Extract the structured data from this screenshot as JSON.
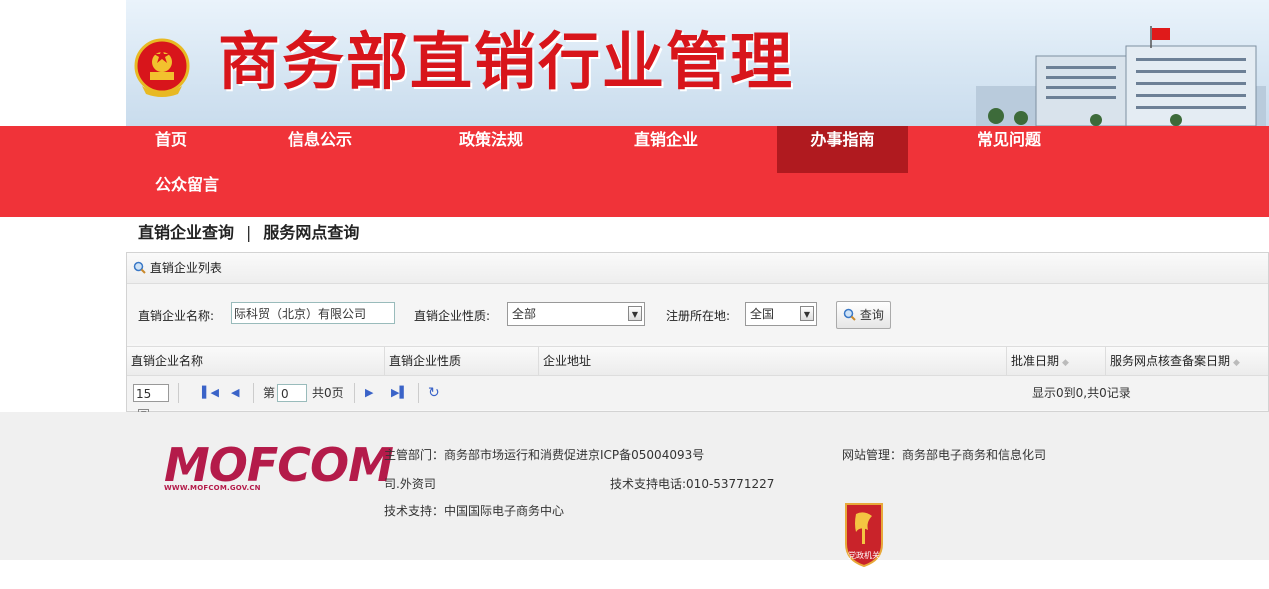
{
  "header": {
    "title": "商务部直销行业管理",
    "colors": {
      "brand_red": "#d8151b",
      "nav_bg": "#f03339",
      "nav_active": "#b01a1f"
    }
  },
  "nav": {
    "items": [
      {
        "label": "首页"
      },
      {
        "label": "信息公示"
      },
      {
        "label": "政策法规"
      },
      {
        "label": "直销企业"
      },
      {
        "label": "办事指南",
        "active": true
      },
      {
        "label": "常见问题"
      },
      {
        "label": "公众留言"
      }
    ]
  },
  "subtabs": {
    "enterprise_query": "直销企业查询",
    "separator": "|",
    "outlet_query": "服务网点查询"
  },
  "panel": {
    "title": "直销企业列表",
    "title_icon": "search-icon",
    "search": {
      "name_label": "直销企业名称:",
      "name_value": "际科贸（北京）有限公司",
      "type_label": "直销企业性质:",
      "type_value": "全部",
      "region_label": "注册所在地:",
      "region_value": "全国",
      "query_button": "查询"
    },
    "columns": [
      {
        "label": "直销企业名称",
        "sortable": false
      },
      {
        "label": "直销企业性质",
        "sortable": false
      },
      {
        "label": "企业地址",
        "sortable": false
      },
      {
        "label": "批准日期",
        "sortable": true
      },
      {
        "label": "服务网点核查备案日期",
        "sortable": true
      }
    ],
    "rows": [],
    "pager": {
      "page_size": "15",
      "page_prefix": "第",
      "page_value": "0",
      "page_total": "共0页",
      "summary": "显示0到0,共0记录"
    }
  },
  "footer": {
    "logo_text": "MOFCOM",
    "logo_url": "WWW.MOFCOM.GOV.CN",
    "dept": "主管部门：商务部市场运行和消费促进京ICP备05004093号",
    "dept_cont": "司.外资司",
    "phone": "技术支持电话:010-53771227",
    "tech": "技术支持：中国国际电子商务中心",
    "manage": "网站管理：商务部电子商务和信息化司",
    "badge_text": "党政机关"
  }
}
